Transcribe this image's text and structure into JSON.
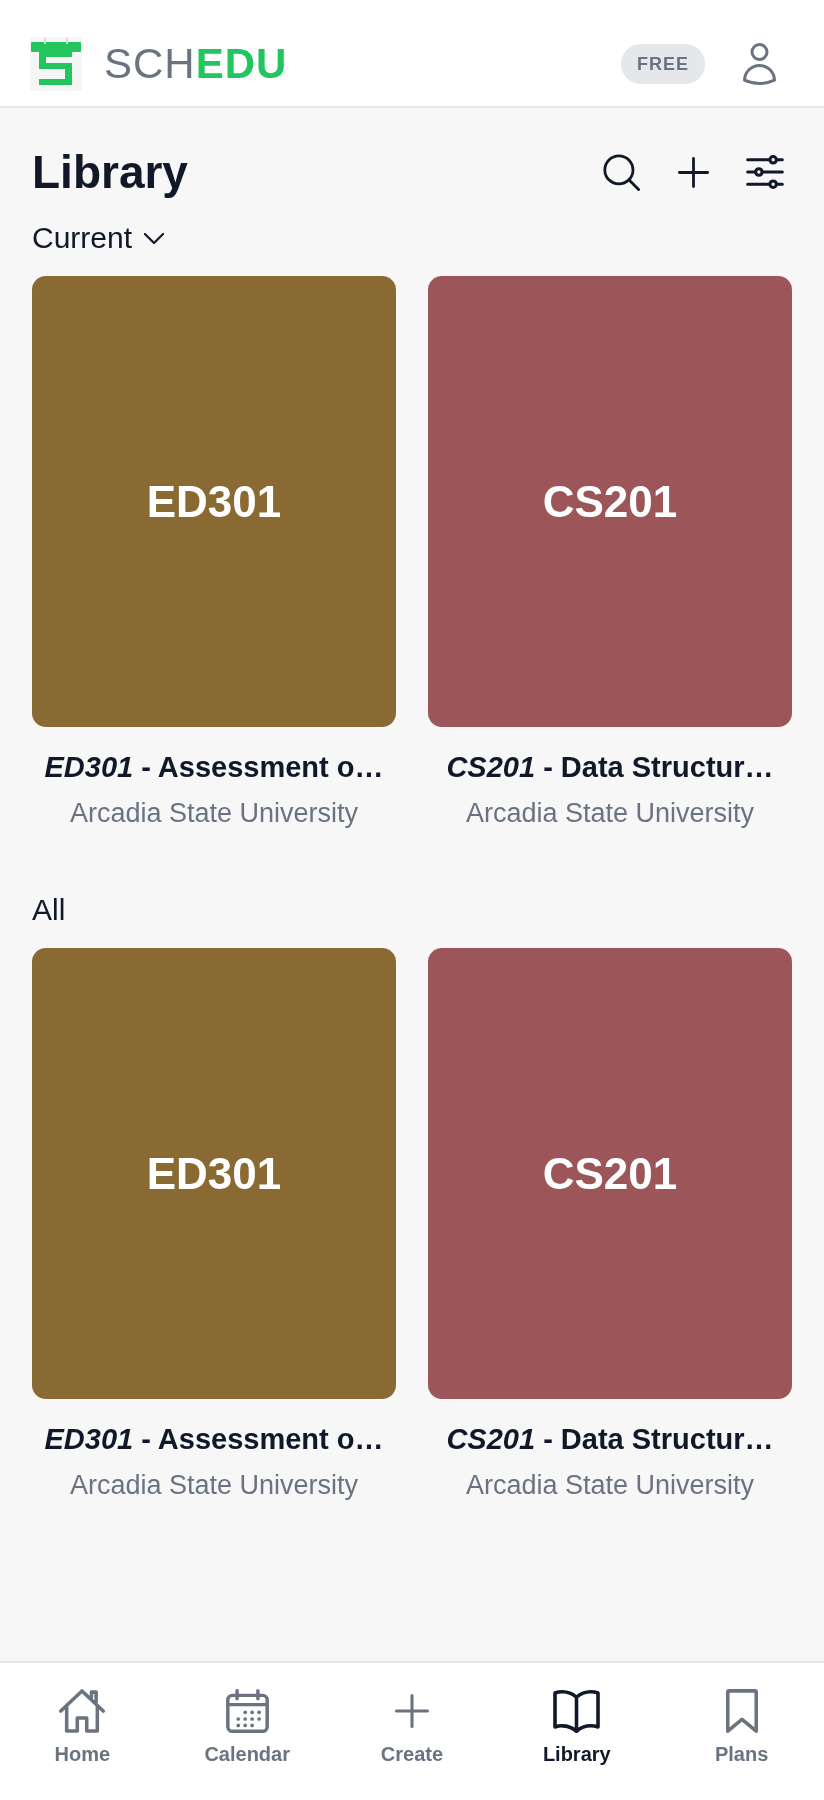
{
  "header": {
    "logo_text": "SCH**EDU**",
    "plan_badge": "FREE"
  },
  "page": {
    "title": "Library"
  },
  "sections": [
    {
      "title": "Current",
      "kind": "dropdown",
      "courses": [
        {
          "code": "ED301",
          "title": "*ED301* - Assessment o…",
          "school": "Arcadia State University",
          "color": "#8a6a33"
        },
        {
          "code": "CS201",
          "title": "*CS201* - Data Structur…",
          "school": "Arcadia State University",
          "color": "#9c5558"
        }
      ]
    },
    {
      "title": "All",
      "kind": "plain",
      "courses": [
        {
          "code": "ED301",
          "title": "*ED301* - Assessment o…",
          "school": "Arcadia State University",
          "color": "#8a6a33"
        },
        {
          "code": "CS201",
          "title": "*CS201* - Data Structur…",
          "school": "Arcadia State University",
          "color": "#9c5558"
        }
      ]
    }
  ],
  "nav": [
    {
      "label": "Home",
      "selected": false
    },
    {
      "label": "Calendar",
      "selected": false
    },
    {
      "label": "Create",
      "selected": false
    },
    {
      "label": "Library",
      "selected": true
    },
    {
      "label": "Plans",
      "selected": false
    }
  ]
}
